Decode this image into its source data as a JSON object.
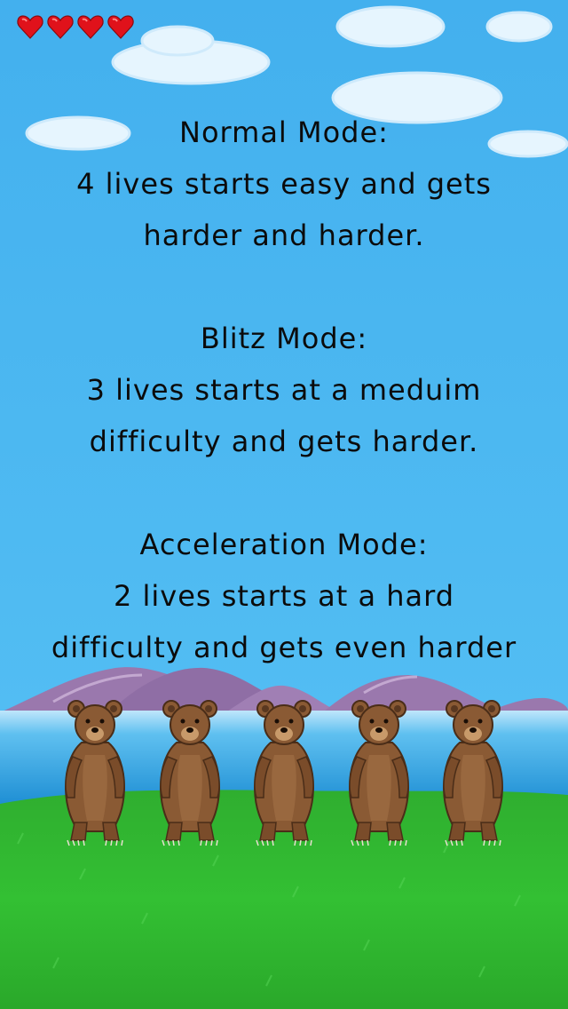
{
  "hud": {
    "lives": 4,
    "heart_icon": "heart-icon",
    "heart_color": "#e0121b"
  },
  "info": {
    "normal": {
      "title": "Normal Mode:",
      "line1": "4 lives starts easy and gets",
      "line2": "harder and harder."
    },
    "blitz": {
      "title": "Blitz Mode:",
      "line1": "3 lives starts at a meduim",
      "line2": "difficulty and gets harder."
    },
    "acceleration": {
      "title": "Acceleration Mode:",
      "line1": "2 lives starts at a hard",
      "line2": "difficulty and gets even harder"
    }
  },
  "scene": {
    "sky_color": "#49b6f0",
    "mountain_color": "#9a78ad",
    "water_color": "#2f9fe0",
    "grass_color": "#2bb62e",
    "bear_count": 5,
    "bear_icon": "bear-icon",
    "bear_color": "#8a5a34"
  }
}
